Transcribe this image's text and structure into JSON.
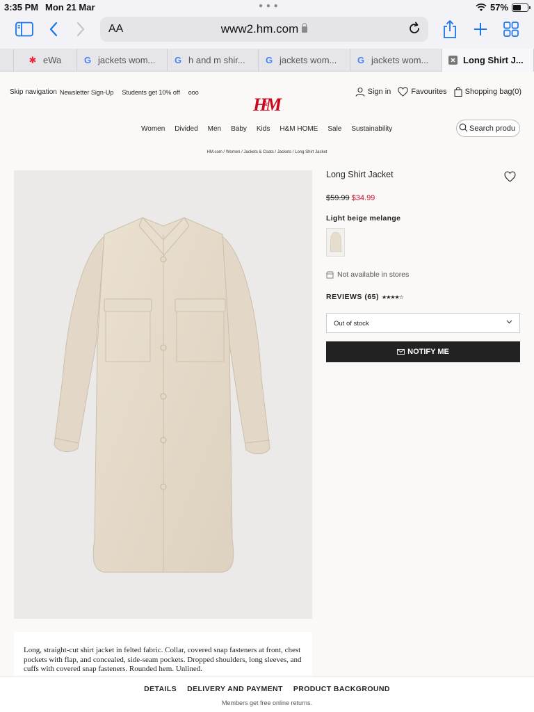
{
  "status_bar": {
    "time": "3:35 PM",
    "date": "Mon 21 Mar",
    "battery": "57%",
    "battery_level": 0.57
  },
  "browser": {
    "text_size_label": "AA",
    "url": "www2.hm.com",
    "tabs": [
      {
        "label": "eWa",
        "favicon": "ewa-favicon"
      },
      {
        "label": "jackets wom...",
        "favicon": "google-icon"
      },
      {
        "label": "h and m shir...",
        "favicon": "google-icon"
      },
      {
        "label": "jackets wom...",
        "favicon": "google-icon"
      },
      {
        "label": "jackets wom...",
        "favicon": "google-icon"
      },
      {
        "label": "Long Shirt J...",
        "favicon": "close-icon",
        "active": true
      }
    ]
  },
  "site": {
    "skip_nav": "Skip navigation",
    "newsletter": "Newsletter Sign-Up",
    "students": "Students get 10% off",
    "more": "ooo",
    "sign_in": "Sign in",
    "favourites": "Favourites",
    "bag": "Shopping bag(0)",
    "logo_text": "H&M",
    "brand_color": "#cc071e",
    "nav": [
      "Women",
      "Divided",
      "Men",
      "Baby",
      "Kids",
      "H&M HOME",
      "Sale",
      "Sustainability"
    ],
    "search_placeholder": "Search produ",
    "breadcrumb": "HM.com / Women / Jackets & Coats / Jackets / Long Shirt Jacket"
  },
  "product": {
    "title": "Long Shirt Jacket",
    "old_price": "$59.99",
    "new_price": "$34.99",
    "sale_color": "#c8102e",
    "color_name": "Light beige melange",
    "availability": "Not available in stores",
    "reviews_label": "REVIEWS (65)",
    "stars": "★★★★☆",
    "rating": 4.5,
    "size_select": "Out of stock",
    "notify_label": "NOTIFY ME",
    "description": "Long, straight-cut shirt jacket in felted fabric. Collar, covered snap fasteners at front, chest pockets with flap, and concealed, side-seam pockets. Dropped shoulders, long sleeves, and cuffs with covered snap fasteners. Rounded hem. Unlined."
  },
  "bottom_sheet": {
    "tabs": [
      "DETAILS",
      "DELIVERY AND PAYMENT",
      "PRODUCT BACKGROUND"
    ],
    "members": "Members get free online returns."
  }
}
